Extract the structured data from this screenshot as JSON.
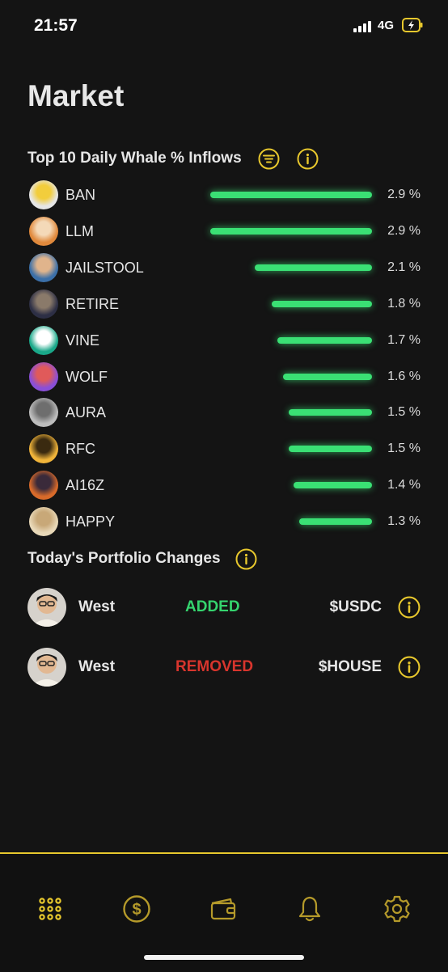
{
  "status_bar": {
    "time": "21:57",
    "network": "4G"
  },
  "page": {
    "title": "Market"
  },
  "inflows": {
    "title": "Top 10 Daily Whale % Inflows",
    "bar_color": "#3ae074",
    "items": [
      {
        "symbol": "BAN",
        "value": 2.9,
        "label": "2.9 %",
        "avatar_colors": [
          "#e6e6e6",
          "#f2cd3c"
        ]
      },
      {
        "symbol": "LLM",
        "value": 2.9,
        "label": "2.9 %",
        "avatar_colors": [
          "#e0893c",
          "#f4d9b8"
        ]
      },
      {
        "symbol": "JAILSTOOL",
        "value": 2.1,
        "label": "2.1 %",
        "avatar_colors": [
          "#3b6fa8",
          "#e0b48c"
        ]
      },
      {
        "symbol": "RETIRE",
        "value": 1.8,
        "label": "1.8 %",
        "avatar_colors": [
          "#2d2f45",
          "#8a7a6a"
        ]
      },
      {
        "symbol": "VINE",
        "value": 1.7,
        "label": "1.7 %",
        "avatar_colors": [
          "#1aa889",
          "#ffffff"
        ]
      },
      {
        "symbol": "WOLF",
        "value": 1.6,
        "label": "1.6 %",
        "avatar_colors": [
          "#8a4fd8",
          "#e05a5a"
        ]
      },
      {
        "symbol": "AURA",
        "value": 1.5,
        "label": "1.5 %",
        "avatar_colors": [
          "#bdbdbd",
          "#6e6e6e"
        ]
      },
      {
        "symbol": "RFC",
        "value": 1.5,
        "label": "1.5 %",
        "avatar_colors": [
          "#f0b43a",
          "#3a2a10"
        ]
      },
      {
        "symbol": "AI16Z",
        "value": 1.4,
        "label": "1.4 %",
        "avatar_colors": [
          "#d86a2a",
          "#3a2a3a"
        ]
      },
      {
        "symbol": "HAPPY",
        "value": 1.3,
        "label": "1.3 %",
        "avatar_colors": [
          "#e8d8b8",
          "#c8a878"
        ]
      }
    ]
  },
  "portfolio": {
    "title": "Today's Portfolio Changes",
    "changes": [
      {
        "user": "West",
        "action": "ADDED",
        "token": "$USDC",
        "action_color": "#35d46e"
      },
      {
        "user": "West",
        "action": "REMOVED",
        "token": "$HOUSE",
        "action_color": "#d8352d"
      }
    ]
  },
  "tab_bar": {
    "accent": "#e8c82d",
    "tabs": [
      {
        "icon": "grid-icon",
        "active": true
      },
      {
        "icon": "dollar-coin-icon",
        "active": false
      },
      {
        "icon": "wallet-icon",
        "active": false
      },
      {
        "icon": "bell-icon",
        "active": false
      },
      {
        "icon": "gear-icon",
        "active": false
      }
    ]
  },
  "colors": {
    "background": "#141414",
    "accent": "#e8c82d"
  }
}
